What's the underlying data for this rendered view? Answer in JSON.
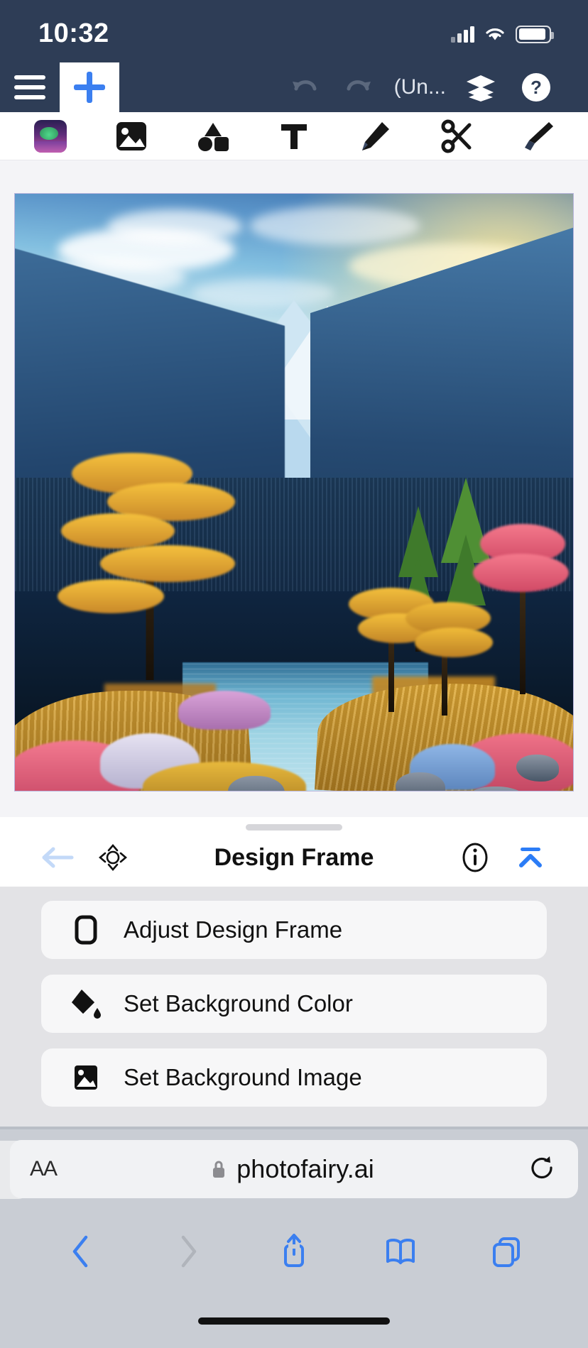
{
  "status_bar": {
    "time": "10:32",
    "icons": [
      "cellular-signal-icon",
      "wifi-icon",
      "battery-icon"
    ]
  },
  "app_bar": {
    "menu_icon": "hamburger-menu-icon",
    "add_icon": "plus-icon",
    "undo_icon": "undo-arrow-icon",
    "redo_icon": "redo-arrow-icon",
    "document_title": "(Un...",
    "layers_icon": "layers-stack-icon",
    "help_icon": "question-mark-help-icon"
  },
  "tool_strip": {
    "tools": [
      {
        "name": "design-thumbnail",
        "icon": "landscape-thumbnail-icon",
        "active": true
      },
      {
        "name": "image-tool",
        "icon": "photo-icon"
      },
      {
        "name": "shapes-tool",
        "icon": "shapes-icon"
      },
      {
        "name": "text-tool",
        "icon": "text-t-icon"
      },
      {
        "name": "draw-tool",
        "icon": "pencil-icon"
      },
      {
        "name": "cut-tool",
        "icon": "scissors-icon"
      },
      {
        "name": "paint-tool",
        "icon": "paintbrush-icon"
      }
    ]
  },
  "canvas": {
    "artwork_alt": "Mountain lake landscape painting with golden and pink trees",
    "border_color": "#b9b6dd",
    "background_color": "#f4f4f7"
  },
  "sheet": {
    "back_icon": "back-arrow-icon",
    "move_icon": "move-diamond-icon",
    "title": "Design Frame",
    "info_icon": "info-circle-icon",
    "collapse_icon": "collapse-chevron-up-icon",
    "options": [
      {
        "icon": "rounded-rectangle-icon",
        "label": "Adjust Design Frame"
      },
      {
        "icon": "paint-bucket-icon",
        "label": "Set Background Color"
      },
      {
        "icon": "photo-icon",
        "label": "Set Background Image"
      }
    ]
  },
  "browser": {
    "text_size_label": "AA",
    "lock_icon": "lock-icon",
    "url": "photofairy.ai",
    "reload_icon": "reload-icon",
    "toolbar": [
      {
        "icon": "back-chevron-icon",
        "enabled": true
      },
      {
        "icon": "forward-chevron-icon",
        "enabled": false
      },
      {
        "icon": "share-icon",
        "enabled": true
      },
      {
        "icon": "bookmarks-book-icon",
        "enabled": true
      },
      {
        "icon": "tabs-icon",
        "enabled": true
      }
    ]
  },
  "colors": {
    "app_bar": "#2e3d56",
    "accent_blue": "#3b7ff0",
    "safari_chrome": "#c9cdd4",
    "sheet_body": "#e3e3e6"
  }
}
